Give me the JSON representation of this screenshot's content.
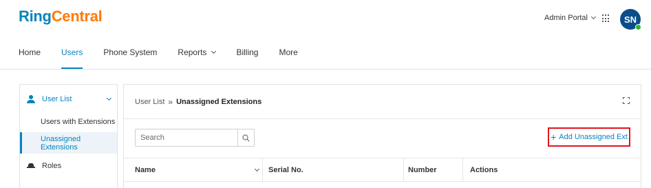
{
  "brand": {
    "ring": "Ring",
    "central": "Central"
  },
  "header": {
    "portal_label": "Admin Portal",
    "avatar_initials": "SN"
  },
  "nav": {
    "items": [
      {
        "label": "Home"
      },
      {
        "label": "Users",
        "active": true
      },
      {
        "label": "Phone System"
      },
      {
        "label": "Reports"
      },
      {
        "label": "Billing"
      },
      {
        "label": "More"
      }
    ]
  },
  "sidebar": {
    "section_label": "User List",
    "items": [
      {
        "label": "Users with Extensions"
      },
      {
        "label": "Unassigned Extensions",
        "active": true
      }
    ],
    "roles_label": "Roles"
  },
  "main": {
    "breadcrumb": {
      "parent": "User List",
      "separator": "»",
      "current": "Unassigned Extensions"
    },
    "search": {
      "placeholder": "Search",
      "value": ""
    },
    "add_button_label": "Add Unassigned Ext",
    "table": {
      "columns": [
        "Name",
        "Serial No.",
        "Number",
        "Actions"
      ]
    }
  },
  "colors": {
    "brand_blue": "#0684bd",
    "brand_orange": "#ff7a00",
    "highlight_red": "#e0141e",
    "avatar_bg": "#0a4d8c",
    "presence_green": "#2eb82e"
  }
}
